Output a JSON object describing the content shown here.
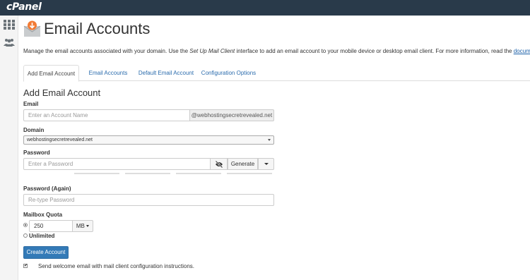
{
  "brand": "cPanel",
  "page": {
    "title": "Email Accounts",
    "description_before": "Manage the email accounts associated with your domain. Use the ",
    "description_em": "Set Up Mail Client",
    "description_after": " interface to add an email account to your mobile device or desktop email client. For more information, read the ",
    "doc_link": "documentation",
    "description_end": "."
  },
  "tabs": [
    "Add Email Account",
    "Email Accounts",
    "Default Email Account",
    "Configuration Options"
  ],
  "form": {
    "heading": "Add Email Account",
    "email_label": "Email",
    "email_placeholder": "Enter an Account Name",
    "email_domain_suffix": "@webhostingsecretrevealed.net",
    "domain_label": "Domain",
    "domain_selected": "webhostingsecretrevealed.net",
    "password_label": "Password",
    "password_placeholder": "Enter a Password",
    "generate_label": "Generate",
    "password_again_label": "Password (Again)",
    "password_again_placeholder": "Re-type Password",
    "quota_label": "Mailbox Quota",
    "quota_value": "250",
    "quota_unit": "MB",
    "unlimited_label": "Unlimited",
    "create_label": "Create Account",
    "welcome_label": "Send welcome email with mail client configuration instructions."
  },
  "colors": {
    "topbar": "#293a4a",
    "link": "#2b6cad",
    "primary": "#337ab7"
  },
  "icons": {
    "brand": "cpanel-logo",
    "apps": "grid-icon",
    "users": "users-icon",
    "title": "email-envelope-icon",
    "visibility": "eye-slash-icon"
  }
}
